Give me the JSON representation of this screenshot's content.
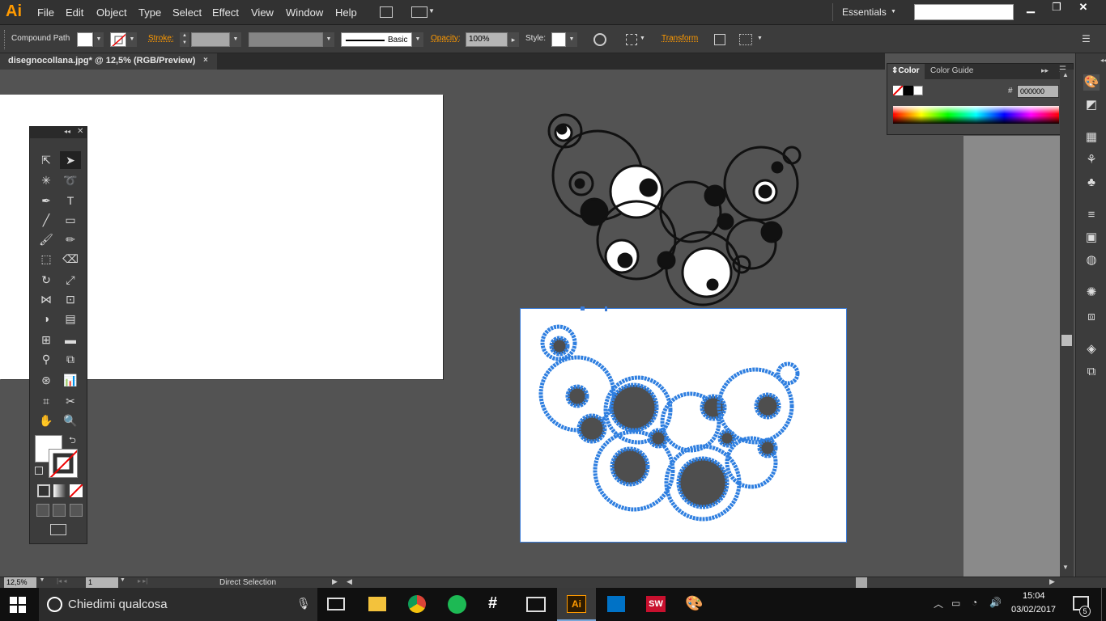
{
  "app": {
    "logo": "Ai"
  },
  "menu": [
    "File",
    "Edit",
    "Object",
    "Type",
    "Select",
    "Effect",
    "View",
    "Window",
    "Help"
  ],
  "workspace": {
    "label": "Essentials",
    "search_value": ""
  },
  "control_bar": {
    "selection_type": "Compound Path",
    "stroke_label": "Stroke:",
    "stroke_style": "Basic",
    "opacity_label": "Opacity:",
    "opacity_value": "100%",
    "style_label": "Style:",
    "transform_label": "Transform"
  },
  "document": {
    "tab_title": "disegnocollana.jpg* @ 12,5% (RGB/Preview)",
    "close": "×"
  },
  "color_panel": {
    "tab_color": "Color",
    "tab_guide": "Color Guide",
    "hash": "#",
    "hex_value": "000000"
  },
  "status_bar": {
    "zoom": "12,5%",
    "artboard_number": "1",
    "tool": "Direct Selection"
  },
  "taskbar": {
    "search_placeholder": "Chiedimi qualcosa",
    "time": "15:04",
    "date": "03/02/2017",
    "notifications": "5",
    "apps": [
      "task-view",
      "file-explorer",
      "chrome",
      "spotify",
      "slack",
      "photos",
      "illustrator",
      "outlook",
      "solidworks",
      "paint"
    ]
  },
  "colors": {
    "accent": "#ff9a00",
    "selection": "#3b7bd6",
    "canvas": "#535353",
    "panel": "#3c3c3c"
  }
}
